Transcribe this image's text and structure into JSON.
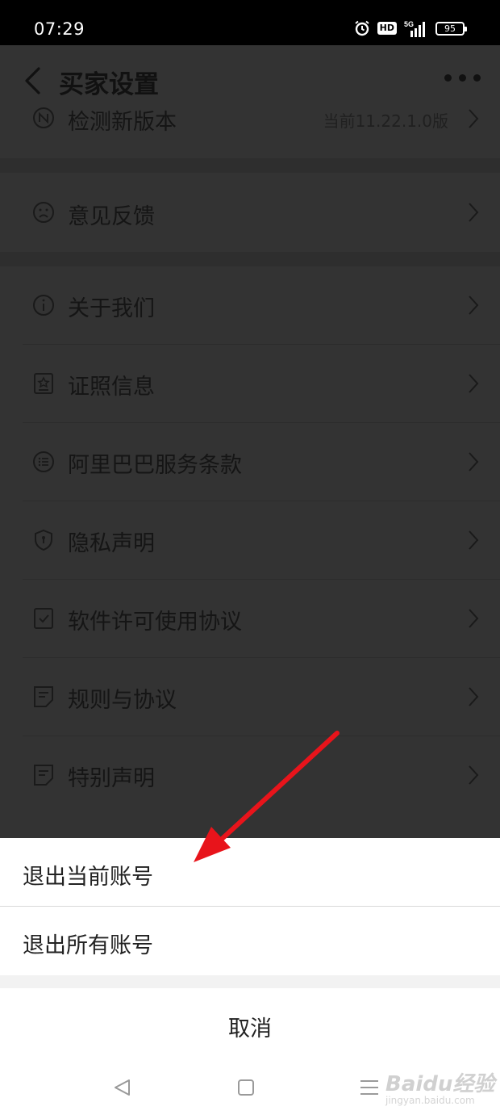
{
  "status_bar": {
    "time": "07:29",
    "hd": "HD",
    "network": "5G",
    "battery": "95"
  },
  "header": {
    "title": "买家设置"
  },
  "settings": {
    "version_check": {
      "label": "检测新版本",
      "value": "当前11.22.1.0版",
      "icon": "version-n-icon"
    },
    "feedback": {
      "label": "意见反馈",
      "icon": "sad-face-icon"
    },
    "about": {
      "label": "关于我们",
      "icon": "info-icon"
    },
    "license_info": {
      "label": "证照信息",
      "icon": "certificate-icon"
    },
    "terms": {
      "label": "阿里巴巴服务条款",
      "icon": "list-icon"
    },
    "privacy": {
      "label": "隐私声明",
      "icon": "shield-icon"
    },
    "software_license": {
      "label": "软件许可使用协议",
      "icon": "checked-doc-icon"
    },
    "rules": {
      "label": "规则与协议",
      "icon": "document-icon"
    },
    "special": {
      "label": "特别声明",
      "icon": "document-icon"
    }
  },
  "sheet": {
    "logout_current": "退出当前账号",
    "logout_all": "退出所有账号",
    "cancel": "取消"
  },
  "watermark": {
    "brand": "Baidu经验",
    "url": "jingyan.baidu.com"
  },
  "colors": {
    "overlay": "#333333",
    "annotation_arrow": "#e8141b",
    "sheet_bg": "#ffffff"
  }
}
